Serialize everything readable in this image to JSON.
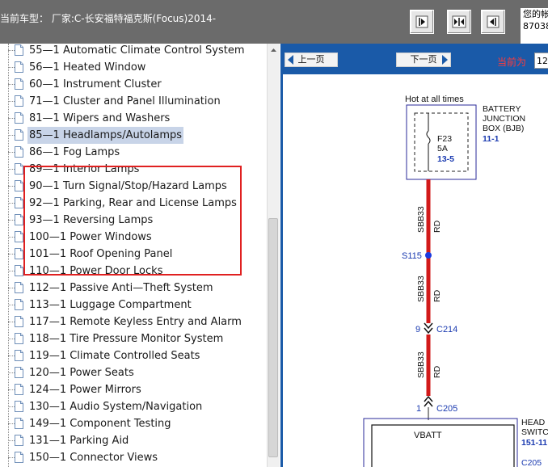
{
  "header": {
    "car_model": "当前车型： 厂家:C-长安福特福克斯(Focus)2014-",
    "user_line1": "您的帐",
    "user_line2": "87038"
  },
  "nav_buttons": [
    "prev-icon",
    "fit-icon",
    "next-icon"
  ],
  "tree": {
    "items": [
      {
        "label": "55—1 Automatic Climate Control System"
      },
      {
        "label": "56—1 Heated Window"
      },
      {
        "label": "60—1 Instrument Cluster"
      },
      {
        "label": "71—1 Cluster and Panel Illumination"
      },
      {
        "label": "81—1 Wipers and Washers"
      },
      {
        "label": "85—1 Headlamps/Autolamps"
      },
      {
        "label": "86—1 Fog Lamps"
      },
      {
        "label": "89—1 Interior Lamps"
      },
      {
        "label": "90—1 Turn Signal/Stop/Hazard Lamps"
      },
      {
        "label": "92—1 Parking, Rear and License Lamps"
      },
      {
        "label": "93—1 Reversing Lamps"
      },
      {
        "label": "100—1 Power Windows"
      },
      {
        "label": "101—1 Roof Opening Panel"
      },
      {
        "label": "110—1 Power Door Locks"
      },
      {
        "label": "112—1 Passive Anti—Theft System"
      },
      {
        "label": "113—1 Luggage Compartment"
      },
      {
        "label": "117—1 Remote Keyless Entry and Alarm"
      },
      {
        "label": "118—1 Tire Pressure Monitor System"
      },
      {
        "label": "119—1 Climate Controlled Seats"
      },
      {
        "label": "120—1 Power Seats"
      },
      {
        "label": "124—1 Power Mirrors"
      },
      {
        "label": "130—1 Audio System/Navigation"
      },
      {
        "label": "149—1 Component Testing"
      },
      {
        "label": "131—1 Parking Aid"
      },
      {
        "label": "150—1 Connector Views"
      }
    ],
    "selected_index": 5
  },
  "diagram_nav": {
    "prev_label": "上一页",
    "next_label": "下一页",
    "current_label": "当前为",
    "page_value": "12"
  },
  "diagram": {
    "hot_label": "Hot at all times",
    "bjb_line1": "BATTERY",
    "bjb_line2": "JUNCTION",
    "bjb_line3": "BOX (BJB)",
    "bjb_ref": "11-1",
    "fuse_name": "F23",
    "fuse_rating": "5A",
    "fuse_ref": "13-5",
    "wire_id_1": "SBB33",
    "wire_color_1": "RD",
    "splice": "S115",
    "wire_id_2": "SBB33",
    "wire_color_2": "RD",
    "pin_1": "9",
    "connector_1": "C214",
    "wire_id_3": "SBB33",
    "wire_color_3": "RD",
    "pin_2": "1",
    "connector_2": "C205",
    "switch_line1": "HEAD",
    "switch_line2": "SWITC",
    "switch_ref": "151-11",
    "vbatt": "VBATT",
    "connector_3": "C205"
  },
  "colors": {
    "header_bg": "#6b6b6b",
    "panel_blue": "#1a5aa8",
    "wire_red": "#d21a1a",
    "ref_blue": "#1a3ab0",
    "highlight_red": "#e02020",
    "current_label": "#ff3a3a"
  }
}
